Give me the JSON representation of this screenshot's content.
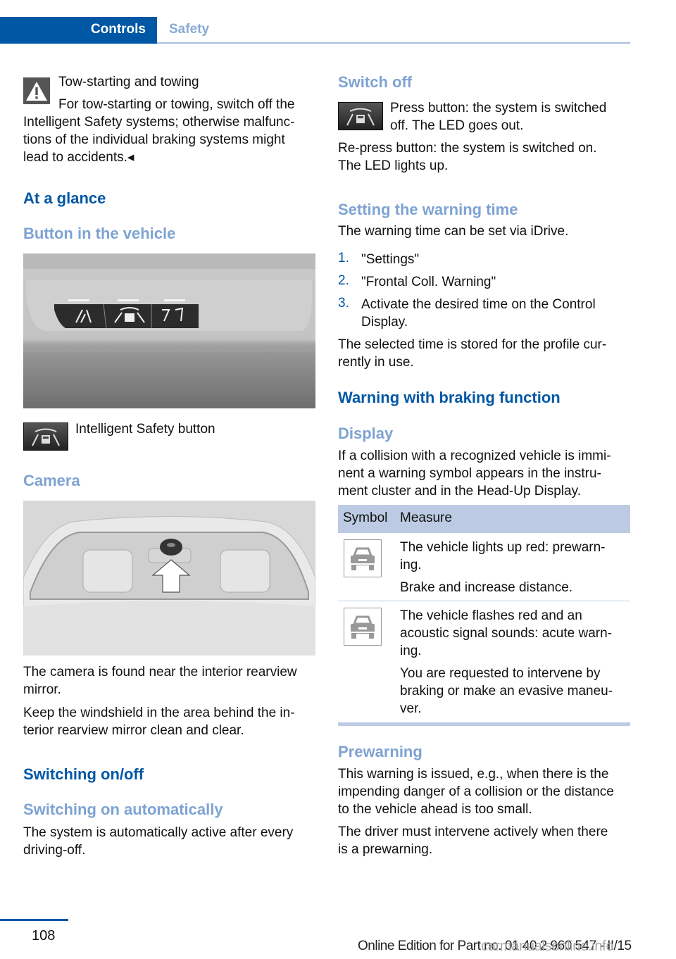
{
  "header": {
    "active_tab": "Controls",
    "inactive_tab": "Safety"
  },
  "left": {
    "warning": {
      "title": "Tow-starting and towing",
      "line1": "For tow-starting or towing, switch off the",
      "line2": "Intelligent Safety systems; otherwise malfunc-",
      "line3": "tions of the individual braking systems might",
      "line4": "lead to accidents.◂"
    },
    "at_a_glance": "At a glance",
    "button_heading": "Button in the vehicle",
    "button_caption": "Intelligent Safety button",
    "camera_heading": "Camera",
    "camera_p1_l1": "The camera is found near the interior rearview",
    "camera_p1_l2": "mirror.",
    "camera_p2_l1": "Keep the windshield in the area behind the in-",
    "camera_p2_l2": "terior rearview mirror clean and clear.",
    "switching_heading": "Switching on/off",
    "auto_heading": "Switching on automatically",
    "auto_l1": "The system is automatically active after every",
    "auto_l2": "driving-off."
  },
  "right": {
    "switch_off_heading": "Switch off",
    "switch_off_l1": "Press button: the system is switched",
    "switch_off_l2": "off. The LED goes out.",
    "repress_l1": "Re-press button: the system is switched on.",
    "repress_l2": "The LED lights up.",
    "warning_time_heading": "Setting the warning time",
    "warning_time_text": "The warning time can be set via iDrive.",
    "steps": [
      {
        "num": "1.",
        "l1": "\"Settings\"",
        "l2": ""
      },
      {
        "num": "2.",
        "l1": "\"Frontal Coll. Warning\"",
        "l2": ""
      },
      {
        "num": "3.",
        "l1": "Activate the desired time on the Control",
        "l2": "Display."
      }
    ],
    "stored_l1": "The selected time is stored for the profile cur-",
    "stored_l2": "rently in use.",
    "braking_heading": "Warning with braking function",
    "display_heading": "Display",
    "display_l1": "If a collision with a recognized vehicle is immi-",
    "display_l2": "nent a warning symbol appears in the instru-",
    "display_l3": "ment cluster and in the Head-Up Display.",
    "table": {
      "col1": "Symbol",
      "col2": "Measure",
      "rows": [
        {
          "icon": "vehicle-warning-icon",
          "l1": "The vehicle lights up red: prewarn-",
          "l2": "ing.",
          "l3": "Brake and increase distance."
        },
        {
          "icon": "vehicle-warning-icon",
          "l1": "The vehicle flashes red and an",
          "l2": "acoustic signal sounds: acute warn-",
          "l3": "ing.",
          "l4": "You are requested to intervene by",
          "l5": "braking or make an evasive maneu-",
          "l6": "ver."
        }
      ]
    },
    "prewarning_heading": "Prewarning",
    "prewarning_p1_l1": "This warning is issued, e.g., when there is the",
    "prewarning_p1_l2": "impending danger of a collision or the distance",
    "prewarning_p1_l3": "to the vehicle ahead is too small.",
    "prewarning_p2_l1": "The driver must intervene actively when there",
    "prewarning_p2_l2": "is a prewarning."
  },
  "footer": {
    "page_number": "108",
    "edition": "Online Edition for Part no. 01 40 2 960 547 - II/15",
    "watermark": "carmanualsonline.info"
  },
  "colors": {
    "brand_blue": "#0057a4",
    "light_blue": "#7ea3d2",
    "table_header": "#bccbe3"
  }
}
